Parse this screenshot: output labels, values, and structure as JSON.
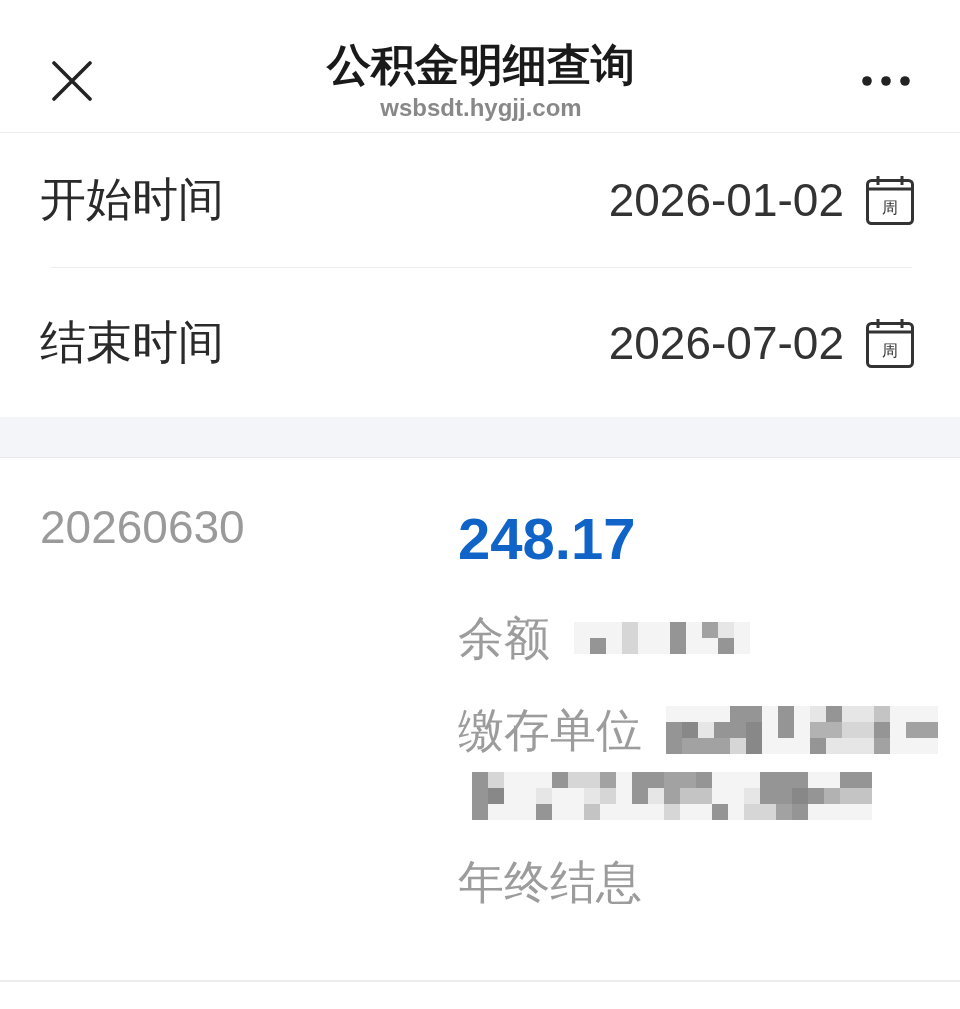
{
  "header": {
    "title": "公积金明细查询",
    "subtitle": "wsbsdt.hygjj.com"
  },
  "date_range": [
    {
      "label": "开始时间",
      "value": "2026-01-02",
      "icon_text": "周"
    },
    {
      "label": "结束时间",
      "value": "2026-07-02",
      "icon_text": "周"
    }
  ],
  "records": [
    {
      "date": "20260630",
      "amount": "248.17",
      "fields": [
        {
          "label": "余额",
          "kind": "masked_short"
        },
        {
          "label": "缴存单位",
          "kind": "masked_long"
        },
        {
          "label": "年终结息",
          "kind": "plain"
        }
      ]
    }
  ]
}
